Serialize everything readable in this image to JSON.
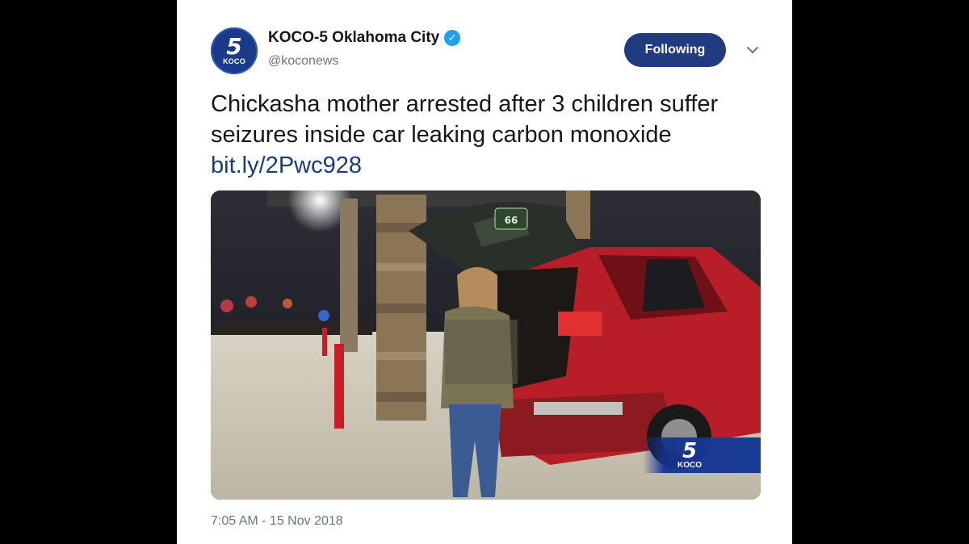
{
  "account": {
    "avatar_number": "5",
    "avatar_label": "KOCO",
    "display_name": "KOCO-5 Oklahoma City",
    "verified_icon": "verified-badge-icon",
    "handle": "@koconews"
  },
  "follow_button": {
    "label": "Following",
    "color": "#223b80"
  },
  "menu": {
    "icon": "chevron-down-icon"
  },
  "tweet": {
    "text": "Chickasha mother arrested after 3 children suffer seizures inside car leaking carbon monoxide",
    "link": "bit.ly/2Pwc928",
    "link_color": "#1b3a82"
  },
  "media": {
    "sign_text": "66",
    "bug_number": "5",
    "bug_label": "KOCO"
  },
  "timestamp": "7:05 AM - 15 Nov 2018"
}
